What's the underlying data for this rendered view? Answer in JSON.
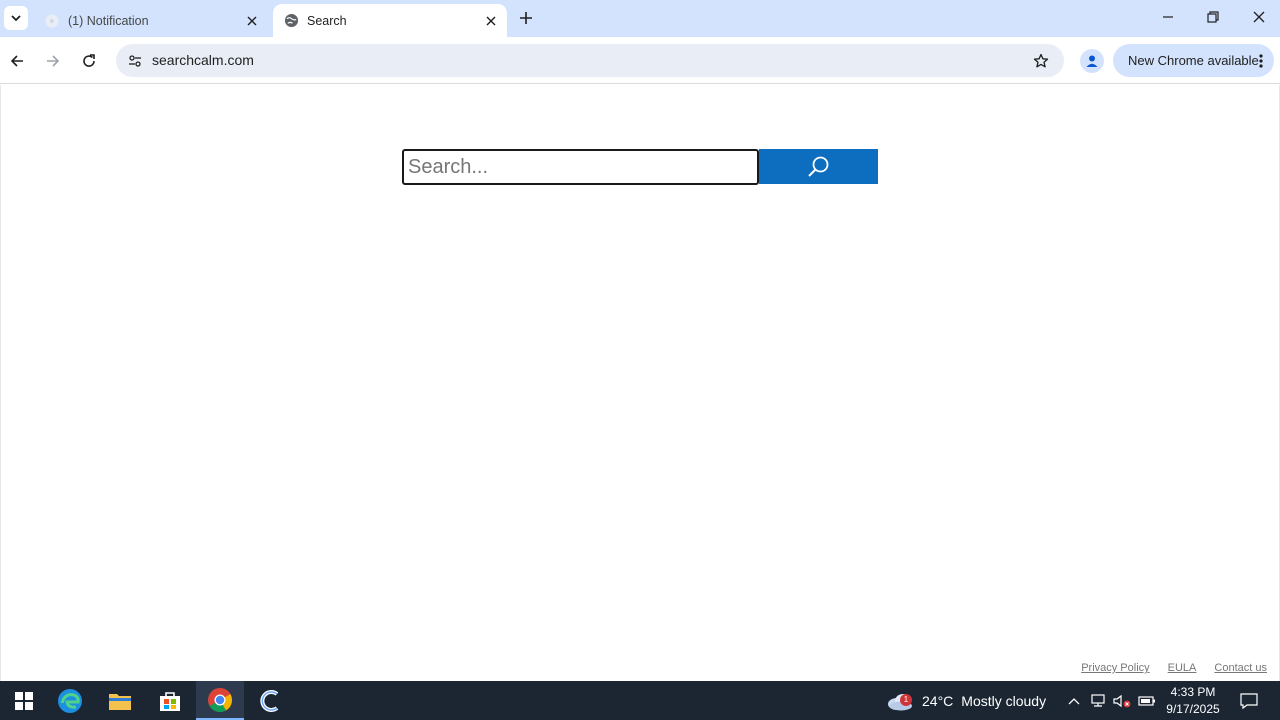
{
  "browser": {
    "tabs": [
      {
        "title": "(1) Notification",
        "icon": "play-icon",
        "active": false
      },
      {
        "title": "Search",
        "icon": "globe-icon",
        "active": true
      }
    ],
    "url": "searchcalm.com",
    "update_label": "New Chrome available"
  },
  "page": {
    "search_placeholder": "Search...",
    "footer_links": [
      "Privacy Policy",
      "EULA",
      "Contact us"
    ]
  },
  "taskbar": {
    "apps": [
      "windows-start-icon",
      "edge-icon",
      "file-explorer-icon",
      "store-icon",
      "chrome-icon",
      "c-app-icon"
    ],
    "weather": {
      "badge": "1",
      "temp": "24°C",
      "desc": "Mostly cloudy"
    },
    "time": "4:33 PM",
    "date": "9/17/2025"
  },
  "colors": {
    "tabstrip": "#d3e3fd",
    "search_button": "#0d6dbf",
    "taskbar": "#1c2633"
  }
}
